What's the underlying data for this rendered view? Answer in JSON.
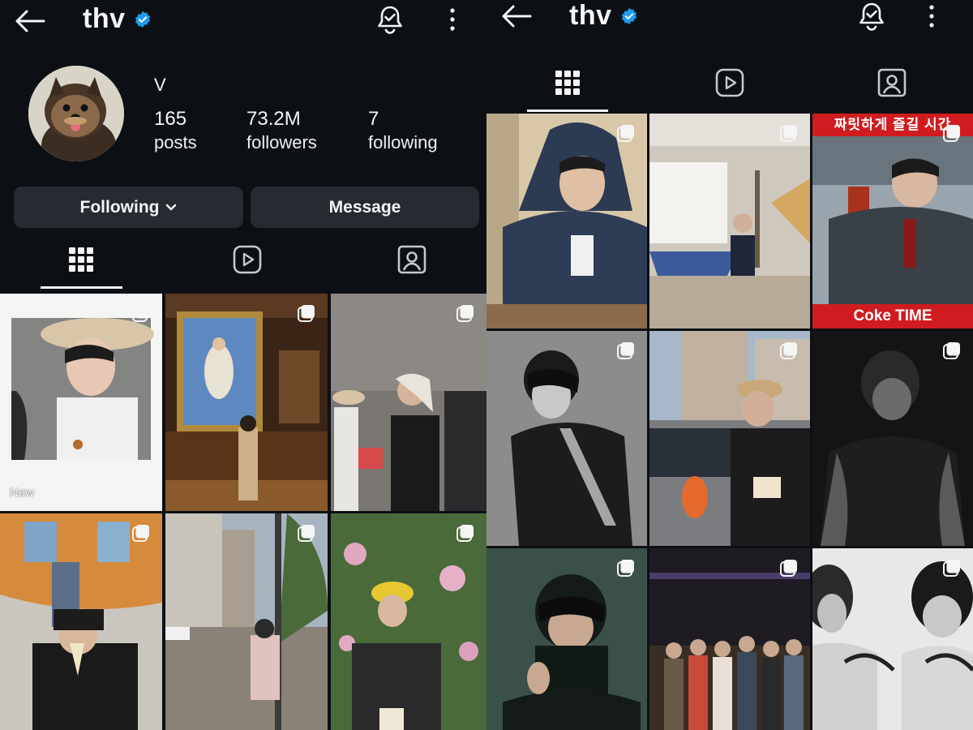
{
  "profile": {
    "handle": "thv",
    "display_name": "V",
    "stats": {
      "posts_count": "165",
      "posts_label": "posts",
      "followers_count": "73.2M",
      "followers_label": "followers",
      "following_count": "7",
      "following_label": "following"
    },
    "following_button": "Following",
    "message_button": "Message"
  },
  "icons": {
    "back": "arrow-left-icon",
    "verified": "verified-badge-icon",
    "notifications": "bell-check-icon",
    "more": "more-vertical-icon",
    "grid_tab": "grid-icon",
    "reels_tab": "reels-icon",
    "tagged_tab": "tagged-icon",
    "multi_post": "carousel-icon"
  },
  "colors": {
    "background": "#0c1014",
    "button": "#262a31",
    "verified": "#1d9bf0",
    "coke_red": "#d01c1f"
  },
  "left_grid": [
    {
      "badge": "New"
    },
    {
      "badge": ""
    },
    {
      "badge": ""
    },
    {
      "badge": ""
    },
    {
      "badge": ""
    },
    {
      "badge": ""
    }
  ],
  "right_grid": [
    {
      "top_text": "",
      "bottom_text": ""
    },
    {
      "top_text": "",
      "bottom_text": ""
    },
    {
      "top_text": "짜릿하게 즐길 시간",
      "bottom_text": "Coke TIME"
    },
    {
      "top_text": "",
      "bottom_text": ""
    },
    {
      "top_text": "",
      "bottom_text": ""
    },
    {
      "top_text": "",
      "bottom_text": ""
    },
    {
      "top_text": "",
      "bottom_text": ""
    },
    {
      "top_text": "",
      "bottom_text": ""
    },
    {
      "top_text": "",
      "bottom_text": ""
    }
  ]
}
